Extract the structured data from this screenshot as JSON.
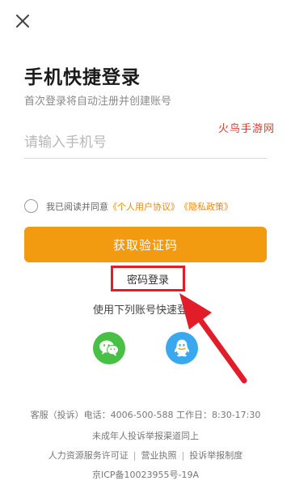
{
  "header": {
    "close_icon": "close-icon"
  },
  "login": {
    "title": "手机快捷登录",
    "subtitle": "首次登录将自动注册并创建账号",
    "phone_placeholder": "请输入手机号",
    "agree_prefix": "我已阅读并同意",
    "user_agreement": "《个人用户协议》",
    "privacy_policy": "《隐私政策》",
    "get_code_button": "获取验证码",
    "password_login": "密码登录",
    "other_methods": "使用下列账号快速登录"
  },
  "social": {
    "wechat_icon": "wechat-icon",
    "qq_icon": "qq-icon"
  },
  "watermark": "火鸟手游网",
  "footer": {
    "service": "客服（投诉）电话：4006-500-588 工作日：8:30-17:30",
    "minor": "未成年人投诉举报渠道同上",
    "links": [
      "人力资源服务许可证",
      "营业执照",
      "投诉举报制度"
    ],
    "separator": "|",
    "icp": "京ICP备10023955号-19A"
  },
  "colors": {
    "primary": "#f29a10",
    "link": "#ee8a10",
    "highlight_box": "#e11d2a",
    "wechat": "#48c046",
    "qq": "#39a8ee"
  }
}
